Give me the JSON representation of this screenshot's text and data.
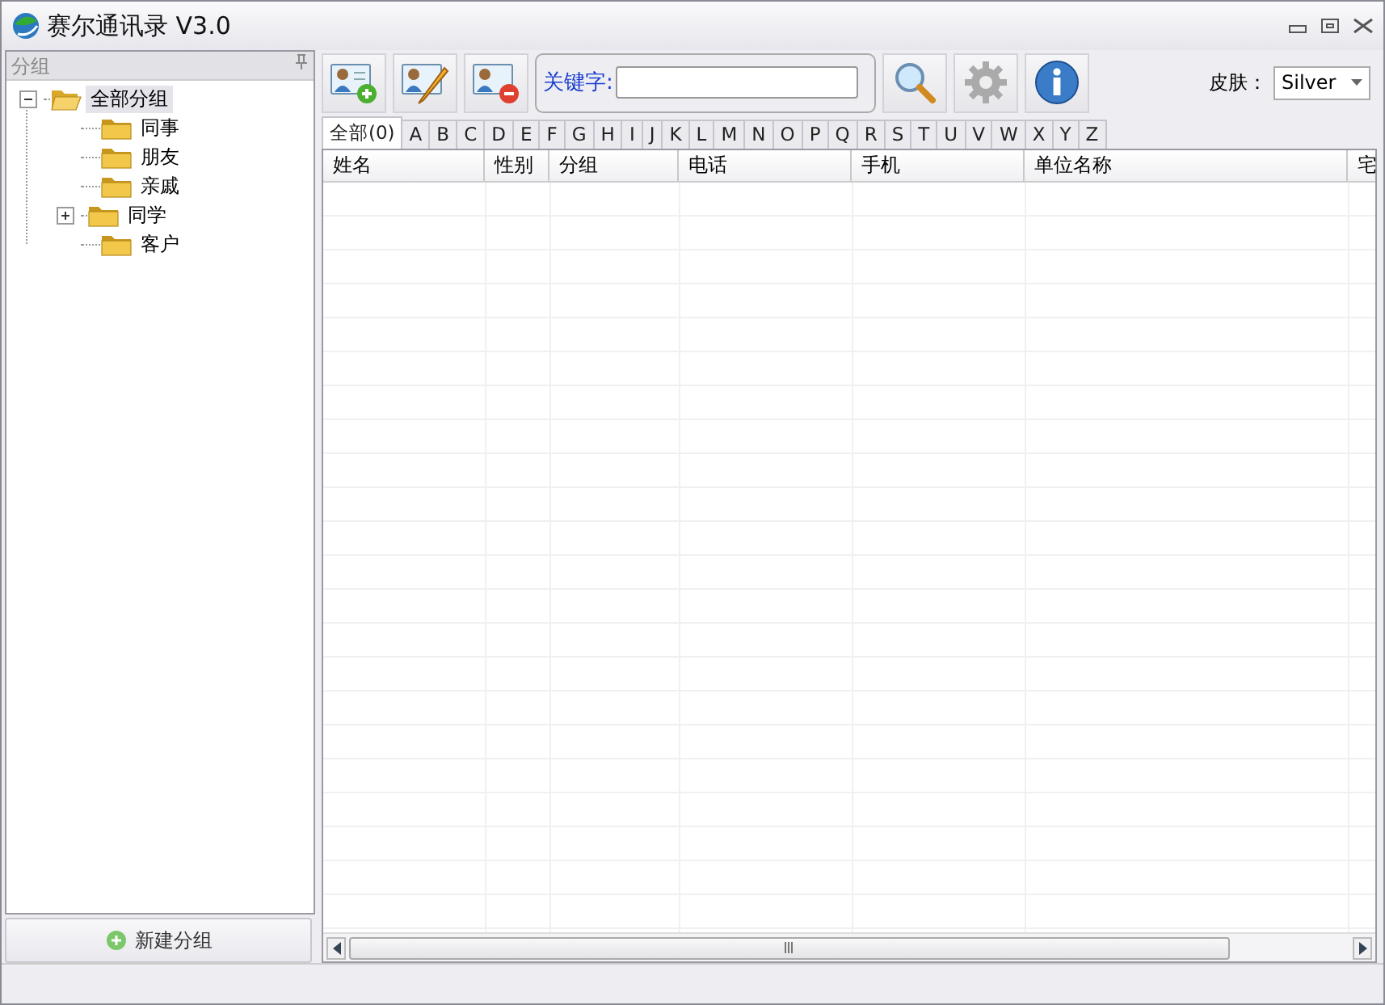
{
  "window": {
    "title": "赛尔通讯录 V3.0"
  },
  "sidebar": {
    "title": "分组",
    "tree": [
      {
        "label": "全部分组",
        "expanded": true,
        "selected": true,
        "children": [
          {
            "label": "同事",
            "selected": false
          },
          {
            "label": "朋友",
            "selected": false
          },
          {
            "label": "亲戚",
            "selected": false
          },
          {
            "label": "同学",
            "expanded": false,
            "selected": false
          },
          {
            "label": "客户",
            "selected": false
          }
        ]
      }
    ],
    "new_group_button": "新建分组"
  },
  "toolbar": {
    "buttons": [
      {
        "kind": "add"
      },
      {
        "kind": "edit"
      },
      {
        "kind": "delete"
      }
    ],
    "search": {
      "label": "关键字:"
    },
    "tools": [
      {
        "kind": "search"
      },
      {
        "kind": "settings"
      },
      {
        "kind": "info"
      }
    ],
    "skin": {
      "label": "皮肤：",
      "value": "Silver"
    }
  },
  "letter_tabs": [
    {
      "label": "全部(0)",
      "selected": true
    },
    {
      "label": "A",
      "selected": false
    },
    {
      "label": "B",
      "selected": false
    },
    {
      "label": "C",
      "selected": false
    },
    {
      "label": "D",
      "selected": false
    },
    {
      "label": "E",
      "selected": false
    },
    {
      "label": "F",
      "selected": false
    },
    {
      "label": "G",
      "selected": false
    },
    {
      "label": "H",
      "selected": false
    },
    {
      "label": "I",
      "selected": false
    },
    {
      "label": "J",
      "selected": false
    },
    {
      "label": "K",
      "selected": false
    },
    {
      "label": "L",
      "selected": false
    },
    {
      "label": "M",
      "selected": false
    },
    {
      "label": "N",
      "selected": false
    },
    {
      "label": "O",
      "selected": false
    },
    {
      "label": "P",
      "selected": false
    },
    {
      "label": "Q",
      "selected": false
    },
    {
      "label": "R",
      "selected": false
    },
    {
      "label": "S",
      "selected": false
    },
    {
      "label": "T",
      "selected": false
    },
    {
      "label": "U",
      "selected": false
    },
    {
      "label": "V",
      "selected": false
    },
    {
      "label": "W",
      "selected": false
    },
    {
      "label": "X",
      "selected": false
    },
    {
      "label": "Y",
      "selected": false
    },
    {
      "label": "Z",
      "selected": false
    }
  ],
  "table": {
    "columns": [
      "姓名",
      "性别",
      "分组",
      "电话",
      "手机",
      "单位名称",
      "宅"
    ]
  }
}
